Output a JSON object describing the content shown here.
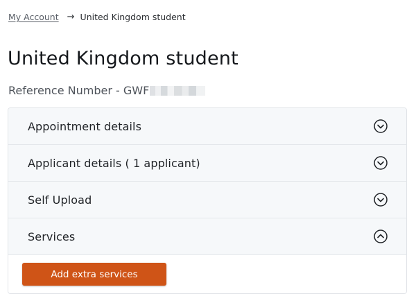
{
  "breadcrumb": {
    "parent": "My Account",
    "separator": "→",
    "current": "United Kingdom student"
  },
  "page": {
    "title": "United Kingdom student",
    "reference_label": "Reference Number - GWF"
  },
  "accordion": {
    "items": [
      {
        "label": "Appointment details",
        "state": "collapsed",
        "icon": "chevron-down-circle-icon"
      },
      {
        "label": "Applicant details ( 1 applicant)",
        "state": "collapsed",
        "icon": "chevron-down-circle-icon"
      },
      {
        "label": "Self Upload",
        "state": "collapsed",
        "icon": "chevron-down-circle-icon"
      },
      {
        "label": "Services",
        "state": "expanded",
        "icon": "chevron-up-circle-icon"
      }
    ]
  },
  "services": {
    "add_button_label": "Add extra services"
  },
  "colors": {
    "accent": "#cf5417",
    "header_bg": "#f6f8fa",
    "border": "#e1e4e8"
  }
}
